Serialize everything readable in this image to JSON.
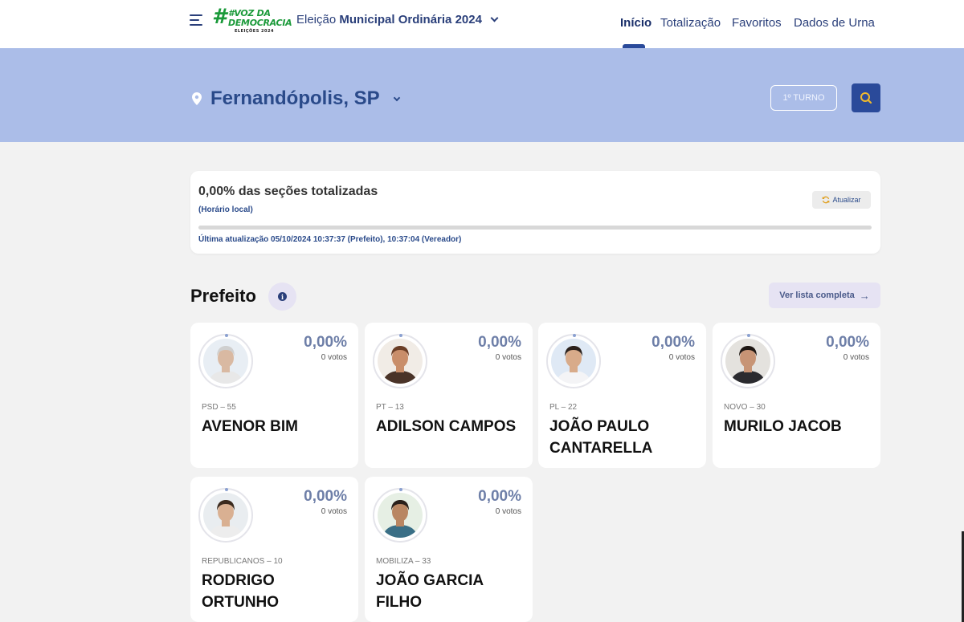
{
  "header": {
    "logo_line1": "#VOZ DA",
    "logo_line2": "DEMOCRACIA",
    "logo_line3": "ELEIÇÕES 2024",
    "election_prefix": "Eleição",
    "election_name": "Municipal Ordinária 2024",
    "nav": [
      "Início",
      "Totalização",
      "Favoritos",
      "Dados de Urna"
    ],
    "active_nav": "Início"
  },
  "banner": {
    "city": "Fernandópolis, SP",
    "turno": "1º TURNO"
  },
  "status": {
    "title": "0,00% das seções totalizadas",
    "local_time": "(Horário local)",
    "refresh_label": "Atualizar",
    "progress_percent": 0,
    "updated": "Última atualização 05/10/2024 10:37:37 (Prefeito), 10:37:04 (Vereador)"
  },
  "section": {
    "title": "Prefeito",
    "full_list": "Ver lista completa"
  },
  "candidates": [
    {
      "party": "PSD – 55",
      "name": "AVENOR BIM",
      "pct": "0,00%",
      "votes": "0 votos",
      "skin": "#d9b9a2",
      "hair": "#cfcfcf",
      "shirt": "#e8e8e8",
      "bg": "#e8eef4"
    },
    {
      "party": "PT – 13",
      "name": "ADILSON CAMPOS",
      "pct": "0,00%",
      "votes": "0 votos",
      "skin": "#c98e6a",
      "hair": "#6b3e26",
      "shirt": "#4a3328",
      "bg": "#f1ece6"
    },
    {
      "party": "PL – 22",
      "name": "JOÃO PAULO CANTARELLA",
      "pct": "0,00%",
      "votes": "0 votos",
      "skin": "#d8ab8a",
      "hair": "#2b211c",
      "shirt": "#f4f4f6",
      "bg": "#dfe9f5"
    },
    {
      "party": "NOVO – 30",
      "name": "MURILO JACOB",
      "pct": "0,00%",
      "votes": "0 votos",
      "skin": "#c79475",
      "hair": "#1d1612",
      "shirt": "#2b2b2f",
      "bg": "#e4e2de"
    },
    {
      "party": "REPUBLICANOS – 10",
      "name": "RODRIGO ORTUNHO",
      "pct": "0,00%",
      "votes": "0 votos",
      "skin": "#d9b092",
      "hair": "#3a2a1e",
      "shirt": "#ededed",
      "bg": "#e9edf0"
    },
    {
      "party": "MOBILIZA – 33",
      "name": "JOÃO GARCIA FILHO",
      "pct": "0,00%",
      "votes": "0 votos",
      "skin": "#b98662",
      "hair": "#2a201a",
      "shirt": "#3a6f86",
      "bg": "#e6efe4"
    }
  ]
}
